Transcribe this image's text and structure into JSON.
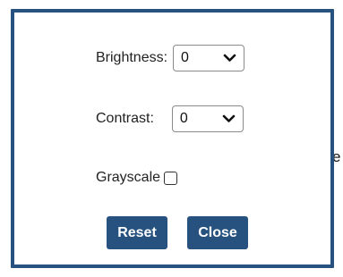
{
  "background": {
    "partial_text": "e"
  },
  "dialog": {
    "brightness": {
      "label": "Brightness:",
      "value": "0"
    },
    "contrast": {
      "label": "Contrast:",
      "value": "0"
    },
    "grayscale": {
      "label": "Grayscale",
      "checked": false
    },
    "buttons": {
      "reset_label": "Reset",
      "close_label": "Close"
    }
  },
  "colors": {
    "accent": "#27527f",
    "button_text": "#ffffff",
    "text": "#222222"
  },
  "icons": {
    "select_chevron": "chevron-down-icon"
  }
}
